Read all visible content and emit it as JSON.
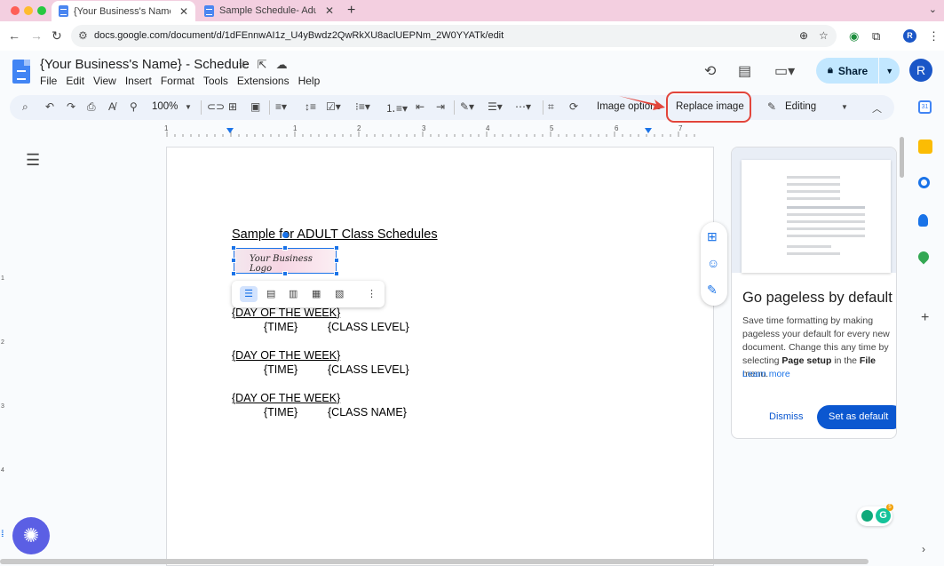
{
  "browser": {
    "tabs": [
      {
        "title": "{Your Business's Name} - Sch",
        "close": "✕"
      },
      {
        "title": "Sample Schedule- Adult Grou",
        "close": "✕"
      }
    ],
    "new_tab": "+",
    "tab_menu": "⌄",
    "url": "docs.google.com/document/d/1dFEnnwAI1z_U4yBwdz2QwRkXU8aclUEPNm_2W0YYATk/edit",
    "profile_initial": "R"
  },
  "doc": {
    "title": "{Your Business's Name} - Schedule",
    "menu": [
      "File",
      "Edit",
      "View",
      "Insert",
      "Format",
      "Tools",
      "Extensions",
      "Help"
    ],
    "share_label": "Share",
    "account_initial": "R"
  },
  "toolbar": {
    "zoom": "100%",
    "image_options": "Image options",
    "replace_image": "Replace image",
    "mode": "Editing"
  },
  "ruler": [
    "1",
    "1",
    "2",
    "3",
    "4",
    "5",
    "6",
    "7"
  ],
  "vruler": [
    "1",
    "2",
    "3",
    "4"
  ],
  "page": {
    "heading": "Sample for ADULT Class Schedules",
    "logo_text": "Your Business Logo",
    "blocks": [
      {
        "day": "{DAY OF THE WEEK}",
        "time": "{TIME}",
        "detail": "{CLASS LEVEL}"
      },
      {
        "day": "{DAY OF THE WEEK}",
        "time": "{TIME}",
        "detail": "{CLASS LEVEL}"
      },
      {
        "day": "{DAY OF THE WEEK}",
        "time": "{TIME}",
        "detail": "{CLASS NAME}"
      }
    ]
  },
  "pageless": {
    "title": "Go pageless by default",
    "body_1": "Save time formatting by making pageless your default for every new document. Change this any time by selecting ",
    "body_bold_1": "Page setup",
    "body_2": " in the ",
    "body_bold_2": "File",
    "body_3": " menu.",
    "link": "Learn more",
    "dismiss": "Dismiss",
    "set_default": "Set as default"
  },
  "grammarly_badge": "5",
  "colors": {
    "accent": "#1a73e8",
    "highlight_red": "#e2453b",
    "share_bg": "#c2e7ff",
    "tab_strip": "#f3cfe0"
  }
}
